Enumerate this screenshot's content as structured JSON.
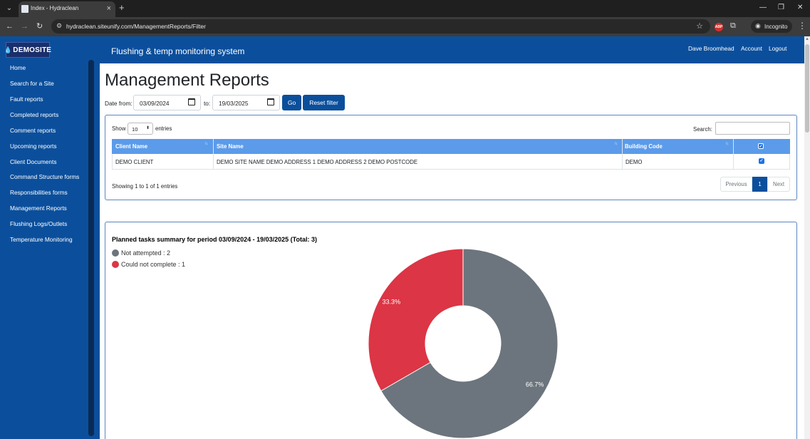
{
  "browser": {
    "tab_title": "Index - Hydraclean",
    "url": "hydraclean.siteunify.com/ManagementReports/Filter",
    "incognito_label": "Incognito",
    "abp_label": "ABP"
  },
  "brand": {
    "logo_text": "DEMOSITE"
  },
  "header": {
    "app_title": "Flushing & temp monitoring system",
    "user_name": "Dave Broomhead",
    "account_link": "Account",
    "logout_link": "Logout"
  },
  "sidebar": {
    "items": [
      {
        "label": "Home"
      },
      {
        "label": "Search for a Site"
      },
      {
        "label": "Fault reports"
      },
      {
        "label": "Completed reports"
      },
      {
        "label": "Comment reports"
      },
      {
        "label": "Upcoming reports"
      },
      {
        "label": "Client Documents"
      },
      {
        "label": "Command Structure forms"
      },
      {
        "label": "Responsibilities forms"
      },
      {
        "label": "Management Reports"
      },
      {
        "label": "Flushing Logs/Outlets"
      },
      {
        "label": "Temperature Monitoring"
      }
    ]
  },
  "filter": {
    "page_title": "Management Reports",
    "date_from_label": "Date from:",
    "date_from_value": "03/09/2024",
    "to_label": "to:",
    "date_to_value": "19/03/2025",
    "go_label": "Go",
    "reset_label": "Reset filter"
  },
  "table": {
    "show_label": "Show",
    "page_size": "10",
    "entries_label": "entries",
    "search_label": "Search:",
    "columns": [
      "Client Name",
      "Site Name",
      "Building Code"
    ],
    "rows": [
      {
        "client": "DEMO CLIENT",
        "site": "DEMO SITE NAME DEMO ADDRESS 1 DEMO ADDRESS 2 DEMO POSTCODE",
        "building": "DEMO"
      }
    ],
    "info": "Showing 1 to 1 of 1 entries",
    "prev_label": "Previous",
    "current_page": "1",
    "next_label": "Next"
  },
  "chart_data": {
    "type": "pie",
    "title": "Planned tasks summary for period 03/09/2024 - 19/03/2025 (Total: 3)",
    "categories": [
      "Not attempted",
      "Could not complete"
    ],
    "values": [
      2,
      1
    ],
    "legend_text": [
      "Not attempted : 2",
      "Could not complete : 1"
    ],
    "percent_labels": [
      "66.7%",
      "33.3%"
    ],
    "colors": [
      "#6c757d",
      "#dc3545"
    ],
    "legend_position": "top-left"
  }
}
